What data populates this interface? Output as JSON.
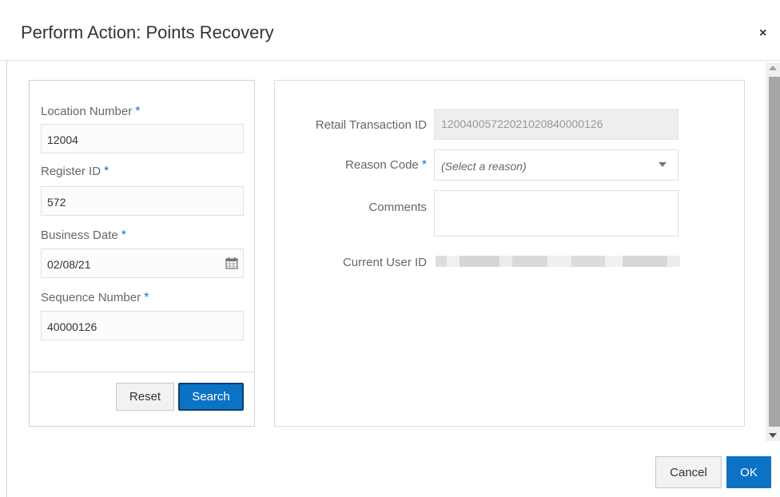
{
  "dialog": {
    "title": "Perform Action: Points Recovery",
    "close_glyph": "×"
  },
  "search": {
    "location_number": {
      "label": "Location Number",
      "required_mark": "*",
      "value": "12004"
    },
    "register_id": {
      "label": "Register ID",
      "required_mark": "*",
      "value": "572"
    },
    "business_date": {
      "label": "Business Date",
      "required_mark": "*",
      "value": "02/08/21",
      "icon": "calendar-icon"
    },
    "sequence_number": {
      "label": "Sequence Number",
      "required_mark": "*",
      "value": "40000126"
    },
    "reset_label": "Reset",
    "search_label": "Search"
  },
  "details": {
    "retail_transaction_id": {
      "label": "Retail Transaction ID",
      "value": "120040057220210208400001​26"
    },
    "reason_code": {
      "label": "Reason Code",
      "required_mark": "*",
      "placeholder": "(Select a reason)"
    },
    "comments": {
      "label": "Comments",
      "value": ""
    },
    "current_user_id": {
      "label": "Current User ID"
    }
  },
  "footer": {
    "cancel_label": "Cancel",
    "ok_label": "OK"
  },
  "colors": {
    "primary": "#0c72c4",
    "required_star": "#1d6fc2"
  }
}
